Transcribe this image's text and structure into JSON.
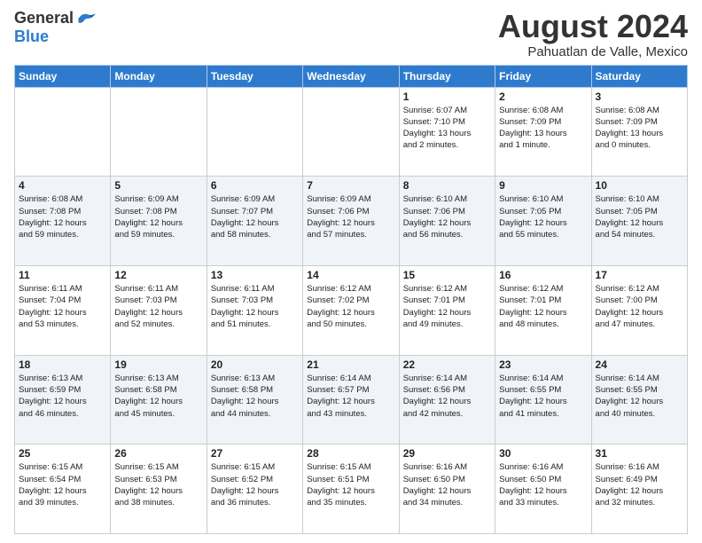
{
  "logo": {
    "general": "General",
    "blue": "Blue"
  },
  "title": "August 2024",
  "subtitle": "Pahuatlan de Valle, Mexico",
  "days_header": [
    "Sunday",
    "Monday",
    "Tuesday",
    "Wednesday",
    "Thursday",
    "Friday",
    "Saturday"
  ],
  "weeks": [
    [
      {
        "day": "",
        "info": ""
      },
      {
        "day": "",
        "info": ""
      },
      {
        "day": "",
        "info": ""
      },
      {
        "day": "",
        "info": ""
      },
      {
        "day": "1",
        "info": "Sunrise: 6:07 AM\nSunset: 7:10 PM\nDaylight: 13 hours\nand 2 minutes."
      },
      {
        "day": "2",
        "info": "Sunrise: 6:08 AM\nSunset: 7:09 PM\nDaylight: 13 hours\nand 1 minute."
      },
      {
        "day": "3",
        "info": "Sunrise: 6:08 AM\nSunset: 7:09 PM\nDaylight: 13 hours\nand 0 minutes."
      }
    ],
    [
      {
        "day": "4",
        "info": "Sunrise: 6:08 AM\nSunset: 7:08 PM\nDaylight: 12 hours\nand 59 minutes."
      },
      {
        "day": "5",
        "info": "Sunrise: 6:09 AM\nSunset: 7:08 PM\nDaylight: 12 hours\nand 59 minutes."
      },
      {
        "day": "6",
        "info": "Sunrise: 6:09 AM\nSunset: 7:07 PM\nDaylight: 12 hours\nand 58 minutes."
      },
      {
        "day": "7",
        "info": "Sunrise: 6:09 AM\nSunset: 7:06 PM\nDaylight: 12 hours\nand 57 minutes."
      },
      {
        "day": "8",
        "info": "Sunrise: 6:10 AM\nSunset: 7:06 PM\nDaylight: 12 hours\nand 56 minutes."
      },
      {
        "day": "9",
        "info": "Sunrise: 6:10 AM\nSunset: 7:05 PM\nDaylight: 12 hours\nand 55 minutes."
      },
      {
        "day": "10",
        "info": "Sunrise: 6:10 AM\nSunset: 7:05 PM\nDaylight: 12 hours\nand 54 minutes."
      }
    ],
    [
      {
        "day": "11",
        "info": "Sunrise: 6:11 AM\nSunset: 7:04 PM\nDaylight: 12 hours\nand 53 minutes."
      },
      {
        "day": "12",
        "info": "Sunrise: 6:11 AM\nSunset: 7:03 PM\nDaylight: 12 hours\nand 52 minutes."
      },
      {
        "day": "13",
        "info": "Sunrise: 6:11 AM\nSunset: 7:03 PM\nDaylight: 12 hours\nand 51 minutes."
      },
      {
        "day": "14",
        "info": "Sunrise: 6:12 AM\nSunset: 7:02 PM\nDaylight: 12 hours\nand 50 minutes."
      },
      {
        "day": "15",
        "info": "Sunrise: 6:12 AM\nSunset: 7:01 PM\nDaylight: 12 hours\nand 49 minutes."
      },
      {
        "day": "16",
        "info": "Sunrise: 6:12 AM\nSunset: 7:01 PM\nDaylight: 12 hours\nand 48 minutes."
      },
      {
        "day": "17",
        "info": "Sunrise: 6:12 AM\nSunset: 7:00 PM\nDaylight: 12 hours\nand 47 minutes."
      }
    ],
    [
      {
        "day": "18",
        "info": "Sunrise: 6:13 AM\nSunset: 6:59 PM\nDaylight: 12 hours\nand 46 minutes."
      },
      {
        "day": "19",
        "info": "Sunrise: 6:13 AM\nSunset: 6:58 PM\nDaylight: 12 hours\nand 45 minutes."
      },
      {
        "day": "20",
        "info": "Sunrise: 6:13 AM\nSunset: 6:58 PM\nDaylight: 12 hours\nand 44 minutes."
      },
      {
        "day": "21",
        "info": "Sunrise: 6:14 AM\nSunset: 6:57 PM\nDaylight: 12 hours\nand 43 minutes."
      },
      {
        "day": "22",
        "info": "Sunrise: 6:14 AM\nSunset: 6:56 PM\nDaylight: 12 hours\nand 42 minutes."
      },
      {
        "day": "23",
        "info": "Sunrise: 6:14 AM\nSunset: 6:55 PM\nDaylight: 12 hours\nand 41 minutes."
      },
      {
        "day": "24",
        "info": "Sunrise: 6:14 AM\nSunset: 6:55 PM\nDaylight: 12 hours\nand 40 minutes."
      }
    ],
    [
      {
        "day": "25",
        "info": "Sunrise: 6:15 AM\nSunset: 6:54 PM\nDaylight: 12 hours\nand 39 minutes."
      },
      {
        "day": "26",
        "info": "Sunrise: 6:15 AM\nSunset: 6:53 PM\nDaylight: 12 hours\nand 38 minutes."
      },
      {
        "day": "27",
        "info": "Sunrise: 6:15 AM\nSunset: 6:52 PM\nDaylight: 12 hours\nand 36 minutes."
      },
      {
        "day": "28",
        "info": "Sunrise: 6:15 AM\nSunset: 6:51 PM\nDaylight: 12 hours\nand 35 minutes."
      },
      {
        "day": "29",
        "info": "Sunrise: 6:16 AM\nSunset: 6:50 PM\nDaylight: 12 hours\nand 34 minutes."
      },
      {
        "day": "30",
        "info": "Sunrise: 6:16 AM\nSunset: 6:50 PM\nDaylight: 12 hours\nand 33 minutes."
      },
      {
        "day": "31",
        "info": "Sunrise: 6:16 AM\nSunset: 6:49 PM\nDaylight: 12 hours\nand 32 minutes."
      }
    ]
  ]
}
